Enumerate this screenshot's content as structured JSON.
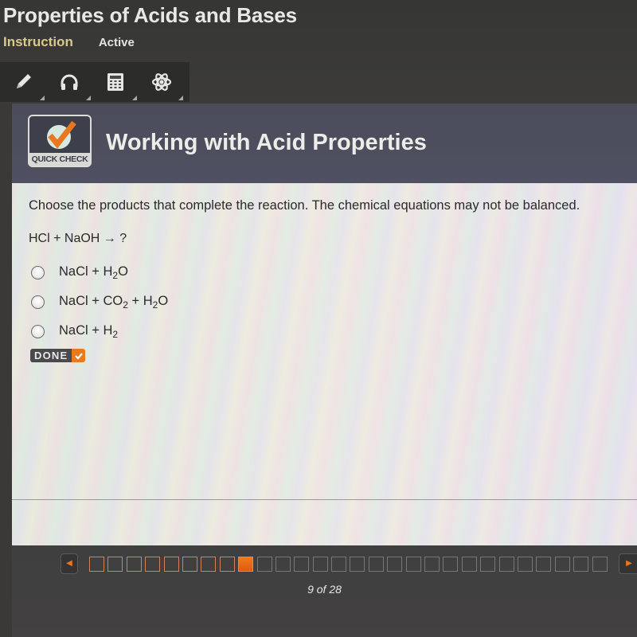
{
  "lesson": {
    "title": "Properties of Acids and Bases",
    "status_tabs": [
      {
        "label": "Instruction",
        "active": true
      },
      {
        "label": "Active",
        "active": false
      }
    ]
  },
  "toolbar": {
    "tools": [
      {
        "name": "pencil-tool",
        "icon": "pencil-icon"
      },
      {
        "name": "audio-tool",
        "icon": "headphones-icon"
      },
      {
        "name": "calculator-tool",
        "icon": "calculator-icon"
      },
      {
        "name": "reference-tool",
        "icon": "atom-icon"
      }
    ]
  },
  "header": {
    "badge_label": "QUICK CHECK",
    "section_title": "Working with Acid Properties"
  },
  "question": {
    "prompt": "Choose the products that complete the reaction. The chemical equations may not be balanced.",
    "equation": "HCl + NaOH → ?",
    "options": [
      {
        "parts": [
          {
            "t": "NaCl + H"
          },
          {
            "sub": "2"
          },
          {
            "t": "O"
          }
        ],
        "text": "NaCl + H2O",
        "selected": false
      },
      {
        "parts": [
          {
            "t": "NaCl + CO"
          },
          {
            "sub": "2"
          },
          {
            "t": " + H"
          },
          {
            "sub": "2"
          },
          {
            "t": "O"
          }
        ],
        "text": "NaCl + CO2 + H2O",
        "selected": false
      },
      {
        "parts": [
          {
            "t": "NaCl + H"
          },
          {
            "sub": "2"
          }
        ],
        "text": "NaCl + H2",
        "selected": false
      }
    ],
    "done_label": "DONE"
  },
  "navigation": {
    "current_page": 9,
    "total_pages": 28,
    "visited_pages": 8,
    "counter_text": "9 of 28",
    "prev_icon": "left-arrow-icon",
    "next_icon": "right-arrow-icon"
  },
  "colors": {
    "accent_orange": "#e8771f",
    "instruction_tab": "#d9c98a",
    "header_band": "#4c4e5e"
  }
}
